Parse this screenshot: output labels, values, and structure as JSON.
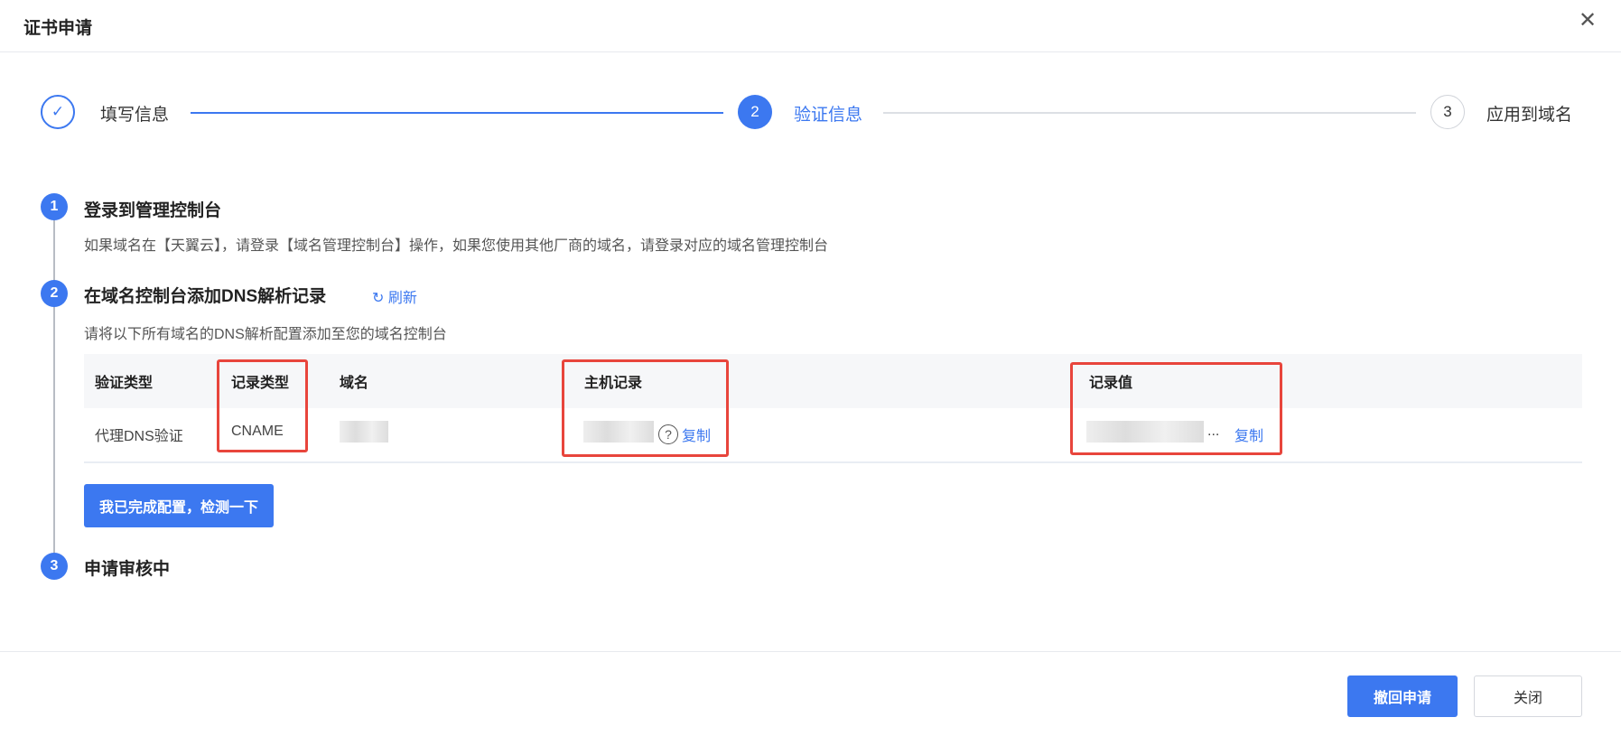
{
  "dialog": {
    "title": "证书申请",
    "close_icon": "close-icon"
  },
  "stepper": {
    "steps": [
      {
        "label": "填写信息",
        "state": "done"
      },
      {
        "label": "验证信息",
        "number": "2",
        "state": "active"
      },
      {
        "label": "应用到域名",
        "number": "3",
        "state": "pending"
      }
    ]
  },
  "sections": [
    {
      "number": "1",
      "title": "登录到管理控制台",
      "desc": "如果域名在【天翼云】，请登录【域名管理控制台】操作，如果您使用其他厂商的域名，请登录对应的域名管理控制台"
    },
    {
      "number": "2",
      "title": "在域名控制台添加DNS解析记录",
      "refresh": "刷新",
      "desc": "请将以下所有域名的DNS解析配置添加至您的域名控制台"
    },
    {
      "number": "3",
      "title": "申请审核中"
    }
  ],
  "table": {
    "headers": [
      "验证类型",
      "记录类型",
      "域名",
      "主机记录",
      "记录值"
    ],
    "row": {
      "verify_type": "代理DNS验证",
      "record_type": "CNAME",
      "ellipsis": "...",
      "copy": "复制"
    }
  },
  "check_button": "我已完成配置，检测一下",
  "footer": {
    "revoke": "撤回申请",
    "close": "关闭"
  },
  "colors": {
    "primary": "#3c78f0",
    "highlight": "#e8453c"
  }
}
